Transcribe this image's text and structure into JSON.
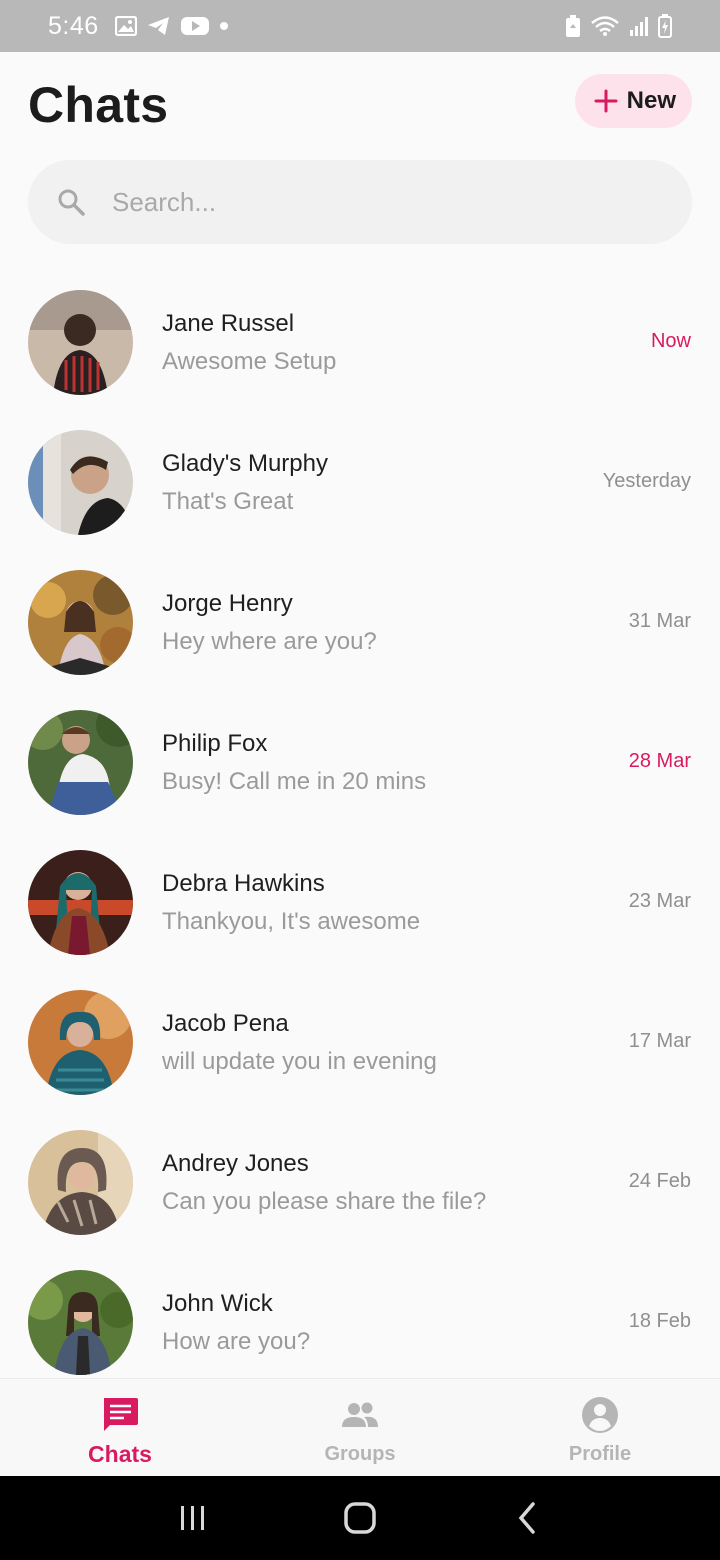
{
  "status_bar": {
    "time": "5:46",
    "left_icons": [
      "gallery-icon",
      "telegram-icon",
      "youtube-icon",
      "dot-icon"
    ],
    "right_icons": [
      "battery-saver-icon",
      "wifi-icon",
      "signal-icon",
      "battery-charging-icon"
    ]
  },
  "header": {
    "title": "Chats",
    "new_button_label": "New"
  },
  "search": {
    "placeholder": "Search..."
  },
  "colors": {
    "accent": "#d81b60",
    "accent_light": "#fde2ec"
  },
  "chats": [
    {
      "name": "Jane Russel",
      "preview": "Awesome Setup",
      "time": "Now",
      "highlight": true
    },
    {
      "name": "Glady's Murphy",
      "preview": "That's Great",
      "time": "Yesterday",
      "highlight": false
    },
    {
      "name": "Jorge Henry",
      "preview": "Hey where are you?",
      "time": "31 Mar",
      "highlight": false
    },
    {
      "name": "Philip Fox",
      "preview": "Busy! Call me in 20 mins",
      "time": "28 Mar",
      "highlight": true
    },
    {
      "name": "Debra Hawkins",
      "preview": "Thankyou, It's awesome",
      "time": "23 Mar",
      "highlight": false
    },
    {
      "name": "Jacob Pena",
      "preview": "will update you in evening",
      "time": "17 Mar",
      "highlight": false
    },
    {
      "name": "Andrey Jones",
      "preview": "Can you please share the file?",
      "time": "24 Feb",
      "highlight": false
    },
    {
      "name": "John Wick",
      "preview": "How are you?",
      "time": "18 Feb",
      "highlight": false
    }
  ],
  "bottom_nav": {
    "items": [
      {
        "label": "Chats",
        "icon": "chat-icon",
        "active": true
      },
      {
        "label": "Groups",
        "icon": "groups-icon",
        "active": false
      },
      {
        "label": "Profile",
        "icon": "profile-icon",
        "active": false
      }
    ]
  },
  "system_nav": [
    "recent-apps-icon",
    "home-icon",
    "back-icon"
  ]
}
